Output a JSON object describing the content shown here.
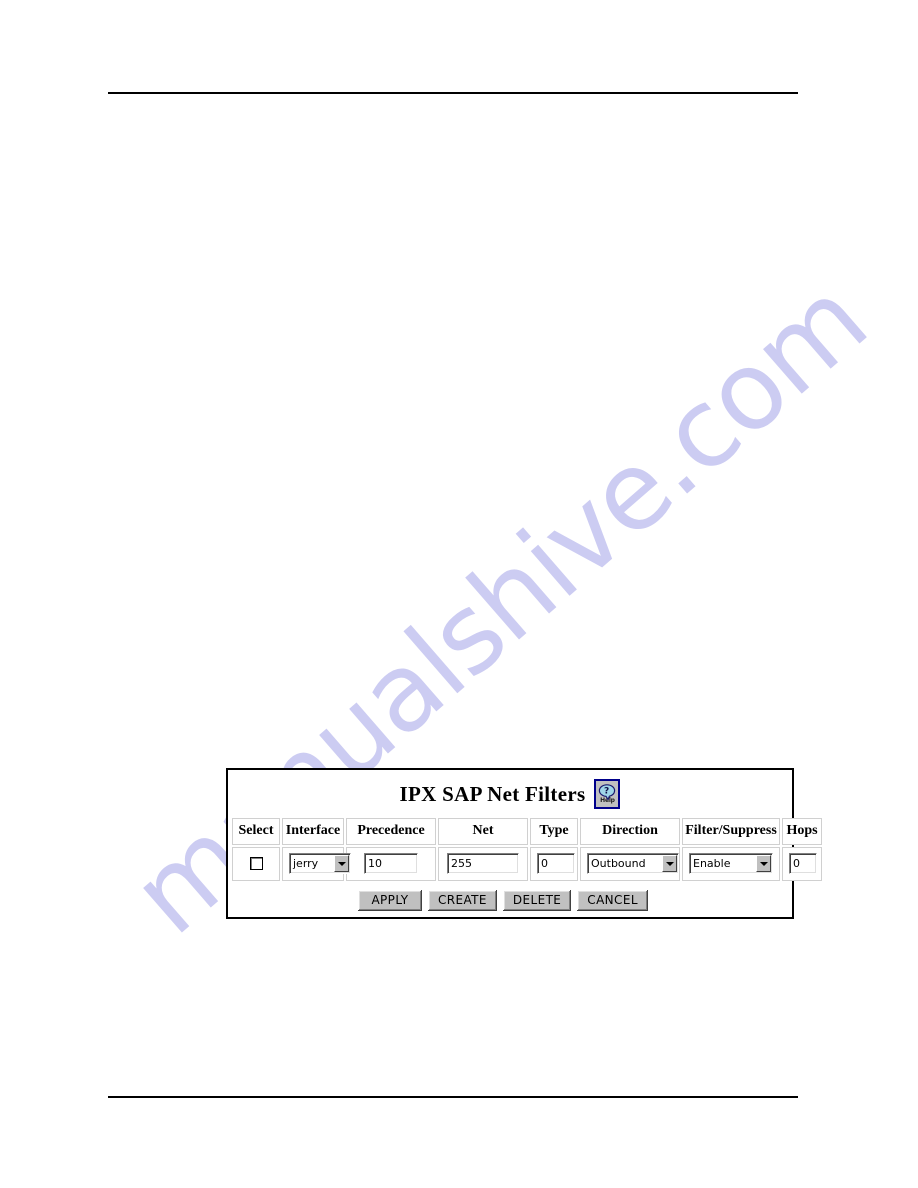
{
  "page": {
    "header_rule": true,
    "footer_rule": true,
    "watermark": "manualshive.com",
    "watermark_color": "#ccccf2"
  },
  "panel": {
    "title": "IPX SAP Net Filters",
    "help_button": {
      "label": "Help",
      "glyph": "?",
      "border_color": "#00008b",
      "bubble_color": "#a8dce8"
    },
    "table": {
      "headers": [
        "Select",
        "Interface",
        "Precedence",
        "Net",
        "Type",
        "Direction",
        "Filter/Suppress",
        "Hops"
      ],
      "rows": [
        {
          "select": {
            "checked": false
          },
          "interface": {
            "value": "jerry"
          },
          "precedence": {
            "value": "10"
          },
          "net": {
            "value": "255"
          },
          "type": {
            "value": "0"
          },
          "direction": {
            "value": "Outbound"
          },
          "filter_suppress": {
            "value": "Enable"
          },
          "hops": {
            "value": "0"
          }
        }
      ]
    },
    "buttons": [
      {
        "label": "APPLY"
      },
      {
        "label": "CREATE"
      },
      {
        "label": "DELETE"
      },
      {
        "label": "CANCEL"
      }
    ]
  }
}
